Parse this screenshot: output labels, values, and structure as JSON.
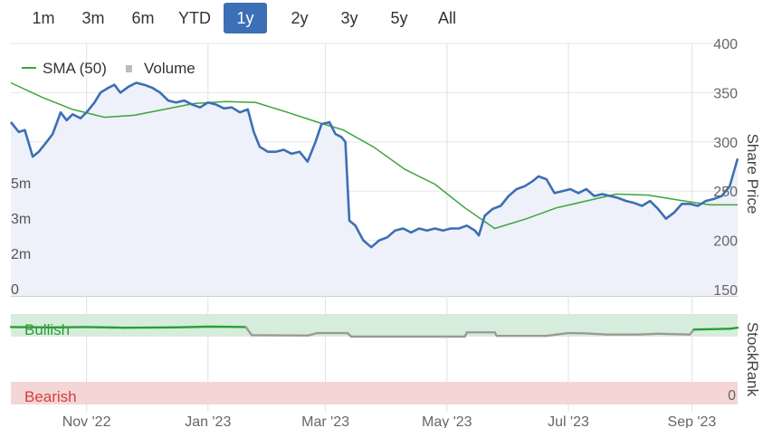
{
  "range_buttons": [
    {
      "label": "1m",
      "active": false
    },
    {
      "label": "3m",
      "active": false
    },
    {
      "label": "6m",
      "active": false
    },
    {
      "label": "YTD",
      "active": false
    },
    {
      "label": "1y",
      "active": true
    },
    {
      "label": "2y",
      "active": false
    },
    {
      "label": "3y",
      "active": false
    },
    {
      "label": "5y",
      "active": false
    },
    {
      "label": "All",
      "active": false
    }
  ],
  "colors": {
    "price": "#3c6fb5",
    "price_fill": "#eef1f9",
    "sma": "#3aa63a",
    "volume": "#c8c8c8",
    "stockrank_bullish": "#2a9d3a",
    "stockrank_neutral": "#9a9a9a",
    "bullish_band": "#d7eddb",
    "bearish_band": "#f5d6d6",
    "bullish_text": "#2a9d3a",
    "bearish_text": "#d04040"
  },
  "chart_data": {
    "type": "line",
    "legend": {
      "position": "top-left",
      "entries": [
        "SMA (50)",
        "Volume"
      ]
    },
    "x_axis": {
      "type": "date",
      "range": [
        "2022-09-24",
        "2023-09-24"
      ],
      "ticks": [
        {
          "date": "2022-11-01",
          "label": "Nov '22"
        },
        {
          "date": "2023-01-01",
          "label": "Jan '23"
        },
        {
          "date": "2023-03-01",
          "label": "Mar '23"
        },
        {
          "date": "2023-05-01",
          "label": "May '23"
        },
        {
          "date": "2023-07-01",
          "label": "Jul '23"
        },
        {
          "date": "2023-09-01",
          "label": "Sep '23"
        }
      ]
    },
    "y_axis": {
      "title": "Share Price",
      "range": [
        150,
        400
      ],
      "ticks": [
        150,
        200,
        250,
        300,
        350,
        400
      ],
      "side": "right",
      "grid": true
    },
    "volume_axis": {
      "ticks": [
        "0",
        "2m",
        "3m",
        "5m"
      ],
      "side": "left"
    },
    "stockrank_axis": {
      "title": "StockRank",
      "range": [
        0,
        100
      ],
      "tick": "0",
      "bullish_label": "Bullish",
      "bearish_label": "Bearish"
    },
    "series": [
      {
        "name": "Share Price",
        "values": [
          [
            "2022-09-24",
            320
          ],
          [
            "2022-09-28",
            310
          ],
          [
            "2022-10-01",
            312
          ],
          [
            "2022-10-05",
            285
          ],
          [
            "2022-10-08",
            290
          ],
          [
            "2022-10-12",
            300
          ],
          [
            "2022-10-15",
            308
          ],
          [
            "2022-10-19",
            330
          ],
          [
            "2022-10-22",
            322
          ],
          [
            "2022-10-25",
            328
          ],
          [
            "2022-10-29",
            324
          ],
          [
            "2022-11-01",
            330
          ],
          [
            "2022-11-05",
            340
          ],
          [
            "2022-11-08",
            350
          ],
          [
            "2022-11-12",
            355
          ],
          [
            "2022-11-15",
            358
          ],
          [
            "2022-11-18",
            350
          ],
          [
            "2022-11-22",
            356
          ],
          [
            "2022-11-26",
            360
          ],
          [
            "2022-11-30",
            358
          ],
          [
            "2022-12-04",
            355
          ],
          [
            "2022-12-08",
            350
          ],
          [
            "2022-12-12",
            342
          ],
          [
            "2022-12-16",
            340
          ],
          [
            "2022-12-20",
            342
          ],
          [
            "2022-12-24",
            338
          ],
          [
            "2022-12-28",
            335
          ],
          [
            "2023-01-01",
            340
          ],
          [
            "2023-01-05",
            338
          ],
          [
            "2023-01-09",
            334
          ],
          [
            "2023-01-13",
            335
          ],
          [
            "2023-01-17",
            330
          ],
          [
            "2023-01-21",
            333
          ],
          [
            "2023-01-24",
            310
          ],
          [
            "2023-01-27",
            295
          ],
          [
            "2023-01-31",
            290
          ],
          [
            "2023-02-04",
            290
          ],
          [
            "2023-02-08",
            292
          ],
          [
            "2023-02-12",
            288
          ],
          [
            "2023-02-16",
            290
          ],
          [
            "2023-02-20",
            280
          ],
          [
            "2023-02-24",
            300
          ],
          [
            "2023-02-27",
            318
          ],
          [
            "2023-03-03",
            320
          ],
          [
            "2023-03-06",
            308
          ],
          [
            "2023-03-09",
            305
          ],
          [
            "2023-03-11",
            300
          ],
          [
            "2023-03-13",
            220
          ],
          [
            "2023-03-16",
            215
          ],
          [
            "2023-03-20",
            200
          ],
          [
            "2023-03-24",
            193
          ],
          [
            "2023-03-28",
            200
          ],
          [
            "2023-04-01",
            203
          ],
          [
            "2023-04-05",
            210
          ],
          [
            "2023-04-09",
            212
          ],
          [
            "2023-04-13",
            208
          ],
          [
            "2023-04-17",
            212
          ],
          [
            "2023-04-21",
            210
          ],
          [
            "2023-04-25",
            212
          ],
          [
            "2023-04-29",
            210
          ],
          [
            "2023-05-03",
            212
          ],
          [
            "2023-05-07",
            212
          ],
          [
            "2023-05-11",
            215
          ],
          [
            "2023-05-15",
            210
          ],
          [
            "2023-05-17",
            205
          ],
          [
            "2023-05-20",
            225
          ],
          [
            "2023-05-24",
            232
          ],
          [
            "2023-05-28",
            235
          ],
          [
            "2023-06-01",
            245
          ],
          [
            "2023-06-05",
            252
          ],
          [
            "2023-06-09",
            255
          ],
          [
            "2023-06-13",
            260
          ],
          [
            "2023-06-16",
            265
          ],
          [
            "2023-06-20",
            262
          ],
          [
            "2023-06-24",
            248
          ],
          [
            "2023-06-28",
            250
          ],
          [
            "2023-07-02",
            252
          ],
          [
            "2023-07-06",
            248
          ],
          [
            "2023-07-10",
            252
          ],
          [
            "2023-07-14",
            245
          ],
          [
            "2023-07-18",
            247
          ],
          [
            "2023-07-22",
            245
          ],
          [
            "2023-07-26",
            243
          ],
          [
            "2023-07-30",
            240
          ],
          [
            "2023-08-03",
            238
          ],
          [
            "2023-08-07",
            235
          ],
          [
            "2023-08-11",
            240
          ],
          [
            "2023-08-15",
            232
          ],
          [
            "2023-08-19",
            222
          ],
          [
            "2023-08-23",
            228
          ],
          [
            "2023-08-27",
            237
          ],
          [
            "2023-08-31",
            237
          ],
          [
            "2023-09-04",
            235
          ],
          [
            "2023-09-08",
            240
          ],
          [
            "2023-09-12",
            242
          ],
          [
            "2023-09-16",
            245
          ],
          [
            "2023-09-20",
            255
          ],
          [
            "2023-09-24",
            283
          ]
        ]
      },
      {
        "name": "SMA (50)",
        "values": [
          [
            "2022-09-24",
            360
          ],
          [
            "2022-10-10",
            345
          ],
          [
            "2022-10-25",
            333
          ],
          [
            "2022-11-10",
            325
          ],
          [
            "2022-11-25",
            327
          ],
          [
            "2022-12-10",
            333
          ],
          [
            "2022-12-25",
            339
          ],
          [
            "2023-01-10",
            341
          ],
          [
            "2023-01-25",
            340
          ],
          [
            "2023-02-10",
            330
          ],
          [
            "2023-02-25",
            320
          ],
          [
            "2023-03-10",
            312
          ],
          [
            "2023-03-25",
            295
          ],
          [
            "2023-04-10",
            272
          ],
          [
            "2023-04-25",
            257
          ],
          [
            "2023-05-10",
            233
          ],
          [
            "2023-05-25",
            212
          ],
          [
            "2023-06-10",
            222
          ],
          [
            "2023-06-25",
            233
          ],
          [
            "2023-07-10",
            240
          ],
          [
            "2023-07-25",
            247
          ],
          [
            "2023-08-10",
            246
          ],
          [
            "2023-08-25",
            241
          ],
          [
            "2023-09-10",
            236
          ],
          [
            "2023-09-24",
            236
          ]
        ]
      },
      {
        "name": "Volume",
        "values": [
          [
            "2022-10-05",
            0.2
          ],
          [
            "2022-10-15",
            0.3
          ],
          [
            "2022-10-25",
            0.3
          ],
          [
            "2022-11-05",
            0.4
          ],
          [
            "2022-11-15",
            0.3
          ],
          [
            "2022-11-22",
            0.8
          ],
          [
            "2022-11-25",
            0.6
          ],
          [
            "2022-12-05",
            0.4
          ],
          [
            "2022-12-15",
            0.3
          ],
          [
            "2022-12-22",
            0.5
          ],
          [
            "2023-01-10",
            0.4
          ],
          [
            "2023-01-24",
            0.3
          ],
          [
            "2023-02-05",
            0.3
          ],
          [
            "2023-02-20",
            0.6
          ],
          [
            "2023-02-27",
            2.3
          ],
          [
            "2023-03-02",
            1.8
          ],
          [
            "2023-03-13",
            1.7
          ],
          [
            "2023-03-15",
            1.0
          ],
          [
            "2023-03-20",
            0.6
          ],
          [
            "2023-04-05",
            0.5
          ],
          [
            "2023-04-15",
            0.4
          ],
          [
            "2023-04-28",
            0.5
          ],
          [
            "2023-05-07",
            2.3
          ],
          [
            "2023-05-10",
            0.8
          ],
          [
            "2023-05-20",
            0.4
          ],
          [
            "2023-06-05",
            0.3
          ],
          [
            "2023-06-20",
            0.3
          ],
          [
            "2023-07-05",
            0.3
          ],
          [
            "2023-07-25",
            0.3
          ],
          [
            "2023-08-15",
            0.3
          ],
          [
            "2023-09-05",
            0.4
          ],
          [
            "2023-09-23",
            0.6
          ]
        ]
      },
      {
        "name": "StockRank",
        "values": [
          [
            "2022-09-24",
            87
          ],
          [
            "2022-10-15",
            86
          ],
          [
            "2022-11-01",
            87
          ],
          [
            "2022-11-20",
            85
          ],
          [
            "2022-12-15",
            86
          ],
          [
            "2023-01-01",
            88
          ],
          [
            "2023-01-20",
            87
          ],
          [
            "2023-01-23",
            64
          ],
          [
            "2023-02-20",
            63
          ],
          [
            "2023-02-25",
            70
          ],
          [
            "2023-03-12",
            70
          ],
          [
            "2023-03-14",
            60
          ],
          [
            "2023-05-10",
            60
          ],
          [
            "2023-05-11",
            72
          ],
          [
            "2023-05-25",
            72
          ],
          [
            "2023-05-26",
            62
          ],
          [
            "2023-06-20",
            62
          ],
          [
            "2023-06-25",
            66
          ],
          [
            "2023-07-01",
            70
          ],
          [
            "2023-07-10",
            69
          ],
          [
            "2023-07-20",
            66
          ],
          [
            "2023-08-05",
            66
          ],
          [
            "2023-08-15",
            68
          ],
          [
            "2023-08-31",
            66
          ],
          [
            "2023-09-02",
            80
          ],
          [
            "2023-09-20",
            82
          ],
          [
            "2023-09-24",
            85
          ]
        ]
      }
    ]
  }
}
